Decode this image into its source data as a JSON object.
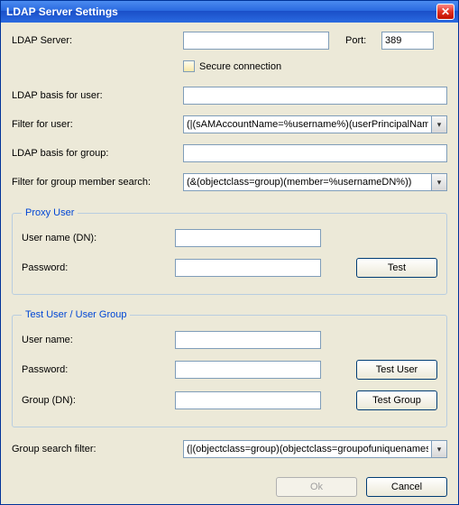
{
  "window": {
    "title": "LDAP Server Settings"
  },
  "server": {
    "label": "LDAP Server:",
    "value": "",
    "port_label": "Port:",
    "port_value": "389",
    "secure_label": "Secure connection",
    "secure_checked": false
  },
  "basis_user": {
    "label": "LDAP basis for user:",
    "value": ""
  },
  "filter_user": {
    "label": "Filter for user:",
    "value": "(|(sAMAccountName=%username%)(userPrincipalName=%"
  },
  "basis_group": {
    "label": "LDAP basis for group:",
    "value": ""
  },
  "filter_group_member": {
    "label": "Filter for group member search:",
    "value": "(&(objectclass=group)(member=%usernameDN%))"
  },
  "proxy": {
    "legend": "Proxy User",
    "username_label": "User name (DN):",
    "username_value": "",
    "password_label": "Password:",
    "password_value": "",
    "test_label": "Test"
  },
  "test": {
    "legend": "Test User / User Group",
    "username_label": "User name:",
    "username_value": "",
    "password_label": "Password:",
    "password_value": "",
    "group_label": "Group (DN):",
    "group_value": "",
    "test_user_label": "Test User",
    "test_group_label": "Test Group"
  },
  "group_search": {
    "label": "Group search filter:",
    "value": "(|(objectclass=group)(objectclass=groupofuniquenames))"
  },
  "buttons": {
    "ok": "Ok",
    "cancel": "Cancel"
  }
}
